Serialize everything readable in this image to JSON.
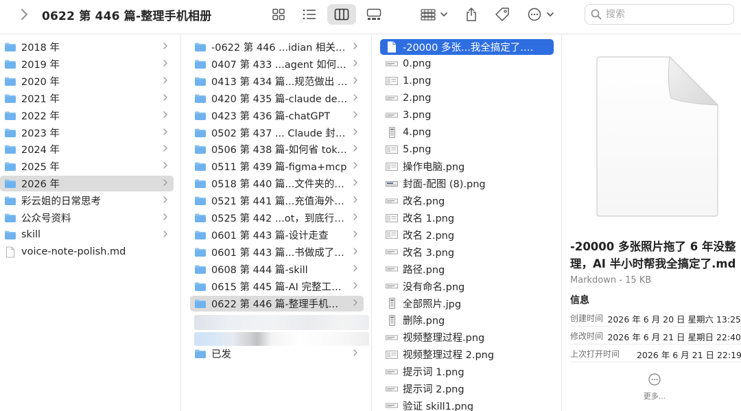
{
  "toolbar": {
    "title": "0622 第 446 篇-整理手机相册",
    "search_placeholder": "搜索",
    "active_view": "columns"
  },
  "colors": {
    "folder": "#6fb2ee",
    "folder_tab": "#8cc3f2",
    "selection_blue": "#2e6ee0",
    "selection_gray": "#dcdcdc"
  },
  "column1": [
    {
      "type": "folder",
      "label": "2018 年"
    },
    {
      "type": "folder",
      "label": "2019 年"
    },
    {
      "type": "folder",
      "label": "2020 年"
    },
    {
      "type": "folder",
      "label": "2021 年"
    },
    {
      "type": "folder",
      "label": "2022 年"
    },
    {
      "type": "folder",
      "label": "2023 年"
    },
    {
      "type": "folder",
      "label": "2024 年"
    },
    {
      "type": "folder",
      "label": "2025 年"
    },
    {
      "type": "folder",
      "label": "2026 年",
      "selected": "gray"
    },
    {
      "type": "folder",
      "label": "彩云姐的日常思考"
    },
    {
      "type": "folder",
      "label": "公众号资料"
    },
    {
      "type": "folder",
      "label": "skill"
    },
    {
      "type": "file",
      "label": "voice-note-polish.md"
    }
  ],
  "column2": [
    {
      "type": "folder",
      "label": "-0622 第 446 ...idian 相关文章"
    },
    {
      "type": "folder",
      "label": "0407 第 433 ...agent 如何协作"
    },
    {
      "type": "folder",
      "label": "0413 第 434 篇...规范做出 skills"
    },
    {
      "type": "folder",
      "label": "0420 第 435 篇-claude design"
    },
    {
      "type": "folder",
      "label": "0423 第 436 篇-chatGPT"
    },
    {
      "type": "folder",
      "label": "0502 第 437 ... Claude 封号这事"
    },
    {
      "type": "folder",
      "label": "0506 第 438 篇-如何省 token?"
    },
    {
      "type": "folder",
      "label": "0511 第 439 篇-figma+mcp"
    },
    {
      "type": "folder",
      "label": "0518 第 440 篇...文件夹的价值?"
    },
    {
      "type": "folder",
      "label": "0521 第 441 篇...充值海外账号"
    },
    {
      "type": "folder",
      "label": "0525 第 442 ...ot，到底行不行?"
    },
    {
      "type": "folder",
      "label": "0601 第 443 篇-设计走查"
    },
    {
      "type": "folder",
      "label": "0601 第 443 篇...书做成了漫剧"
    },
    {
      "type": "folder",
      "label": "0608 第 444 篇-skill"
    },
    {
      "type": "folder",
      "label": "0615 第 445 篇-AI 完整工作流"
    },
    {
      "type": "folder",
      "label": "0622 第 446 篇-整理手机相册",
      "selected": "gray"
    },
    {
      "type": "folder",
      "label": "已发"
    }
  ],
  "column3": [
    {
      "icon": "doc",
      "label": "-20000 多张...我全搞定了.md",
      "selected": "blue"
    },
    {
      "icon": "wide",
      "label": "0.png"
    },
    {
      "icon": "img",
      "label": "1.png"
    },
    {
      "icon": "wide",
      "label": "2.png"
    },
    {
      "icon": "wide",
      "label": "3.png"
    },
    {
      "icon": "tall",
      "label": "4.png"
    },
    {
      "icon": "img",
      "label": "5.png"
    },
    {
      "icon": "img",
      "label": "操作电脑.png"
    },
    {
      "icon": "cover",
      "label": "封面-配图 (8).png"
    },
    {
      "icon": "wide",
      "label": "改名.png"
    },
    {
      "icon": "img",
      "label": "改名 1.png"
    },
    {
      "icon": "img",
      "label": "改名 2.png"
    },
    {
      "icon": "wide",
      "label": "改名 3.png"
    },
    {
      "icon": "wide",
      "label": "路径.png"
    },
    {
      "icon": "wide",
      "label": "没有命名.png"
    },
    {
      "icon": "tall",
      "label": "全部照片.jpg"
    },
    {
      "icon": "tall",
      "label": "删除.png"
    },
    {
      "icon": "wide",
      "label": "视频整理过程.png"
    },
    {
      "icon": "img",
      "label": "视频整理过程 2.png"
    },
    {
      "icon": "wide",
      "label": "提示词 1.png"
    },
    {
      "icon": "wide",
      "label": "提示词 2.png"
    },
    {
      "icon": "wide",
      "label": "验证 skill1.png"
    }
  ],
  "preview": {
    "file_name": "-20000 多张照片拖了 6 年没整理，AI 半小时帮我全搞定了.md",
    "kind_size": "Markdown - 15 KB",
    "info_heading": "信息",
    "info": [
      {
        "label": "创建时间",
        "value": "2026 年 6 月 20 日 星期六 13:25"
      },
      {
        "label": "修改时间",
        "value": "2026 年 6 月 21 日 星期日 22:40"
      },
      {
        "label": "上次打开时间",
        "value": "2026 年 6 月 21 日 22:19"
      }
    ],
    "more_label": "更多..."
  }
}
